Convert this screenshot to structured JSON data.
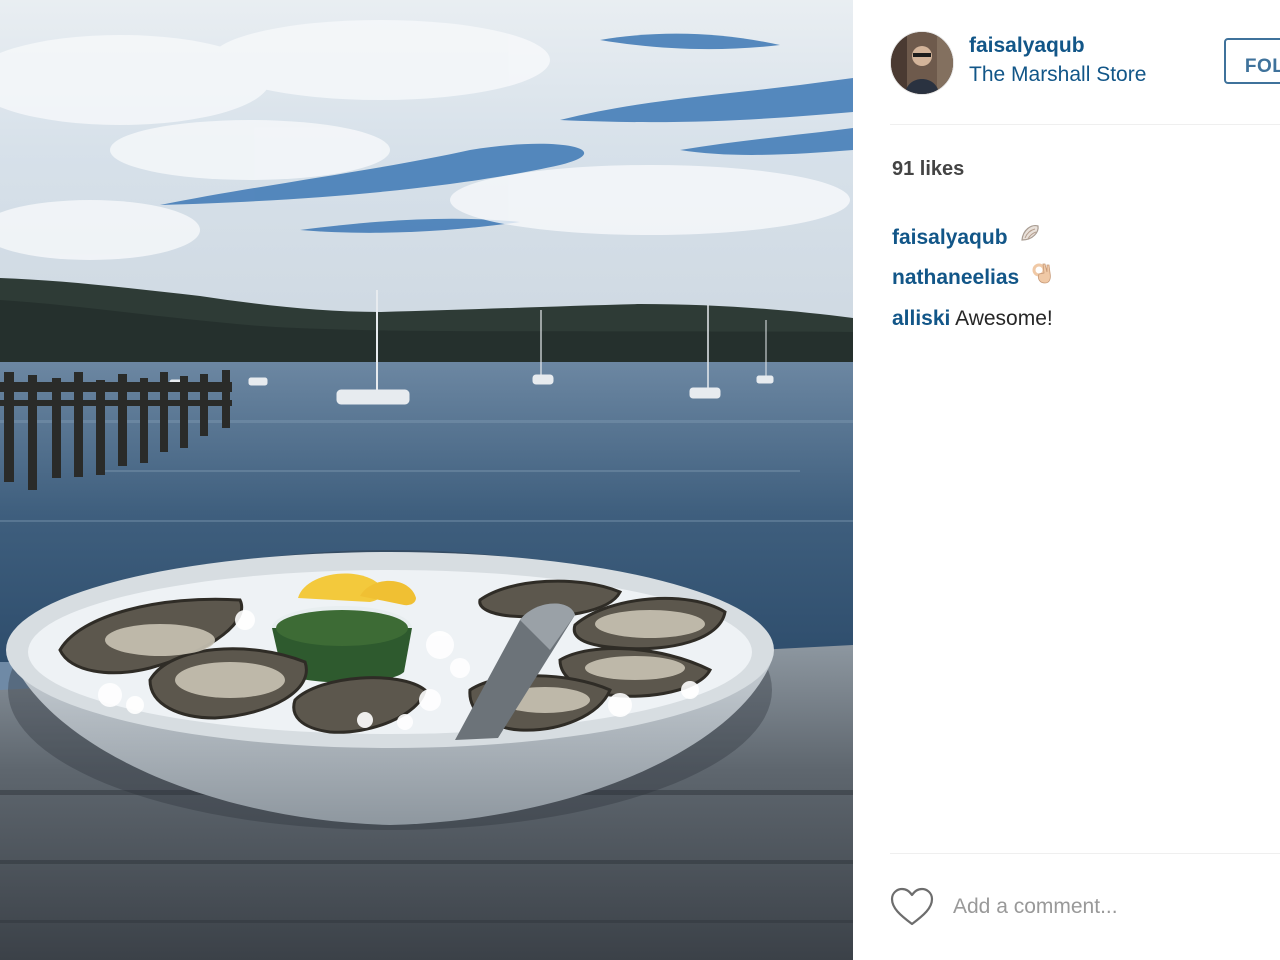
{
  "post": {
    "username": "faisalyaqub",
    "location": "The Marshall Store",
    "follow_label": "FOLLOW",
    "likes": "91 likes",
    "comments": [
      {
        "user": "faisalyaqub",
        "text": "",
        "emoji": "spiral-shell"
      },
      {
        "user": "nathaneelias",
        "text": "",
        "emoji": "ok-hand"
      },
      {
        "user": "alliski",
        "text": "Awesome!"
      }
    ],
    "comment_placeholder": "Add a comment..."
  },
  "colors": {
    "link": "#125688",
    "follow_border": "#3f729b",
    "muted": "#999999"
  },
  "icons": {
    "like": "heart-outline-icon"
  }
}
